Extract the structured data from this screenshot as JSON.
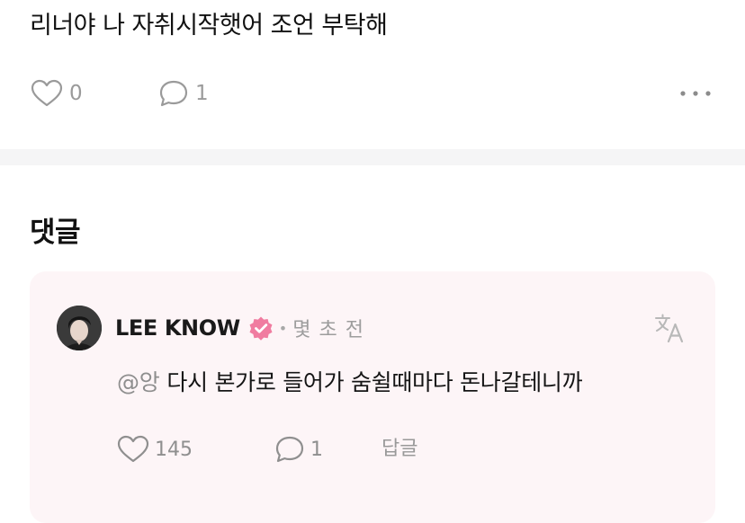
{
  "post": {
    "text": "리너야 나 자취시작햇어 조언 부탁해",
    "like_count": "0",
    "comment_count": "1",
    "more_icon": "more-dots-icon"
  },
  "comments_section": {
    "title": "댓글"
  },
  "comment": {
    "author": "LEE KNOW",
    "verified_icon": "verified-badge-icon",
    "verified_color": "#f07ca0",
    "separator": "•",
    "time": "몇 초 전",
    "translate_icon": "translate-icon",
    "mention": "@앙",
    "text": "다시 본가로 들어가 숨쉴때마다 돈나갈테니까",
    "like_count": "145",
    "reply_count": "1",
    "reply_label": "답글"
  },
  "colors": {
    "card_background": "#fdf5f7",
    "separator_background": "#f5f5f6",
    "muted_text": "#9a9a9a"
  }
}
